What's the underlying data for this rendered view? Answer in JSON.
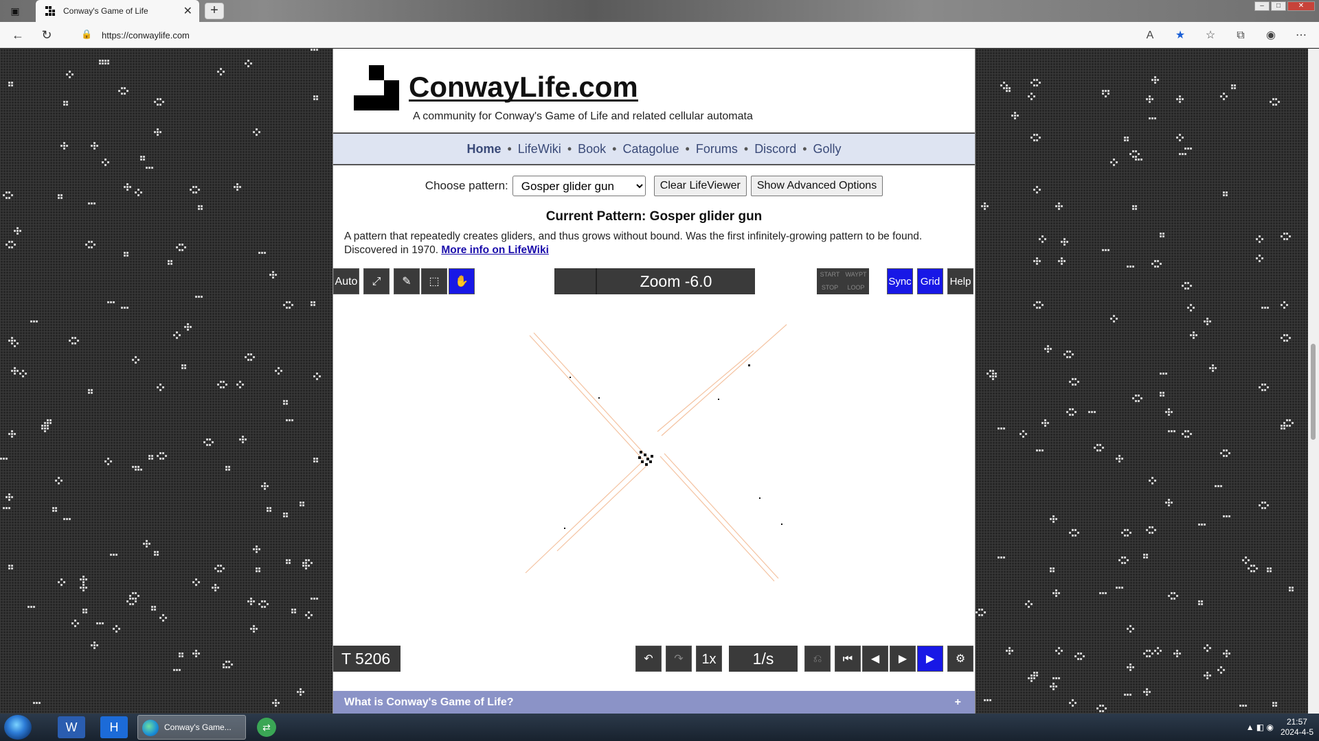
{
  "browser": {
    "tab_title": "Conway's Game of Life",
    "url": "https://conwaylife.com"
  },
  "site": {
    "title": "ConwayLife.com",
    "tagline": "A community for Conway's Game of Life and related cellular automata"
  },
  "nav": {
    "items": [
      "Home",
      "LifeWiki",
      "Book",
      "Catagolue",
      "Forums",
      "Discord",
      "Golly"
    ],
    "separator": "•"
  },
  "chooser": {
    "label": "Choose pattern:",
    "selected": "Gosper glider gun",
    "clear_button": "Clear LifeViewer",
    "advanced_button": "Show Advanced Options"
  },
  "pattern": {
    "heading": "Current Pattern: Gosper glider gun",
    "description": "A pattern that repeatedly creates gliders, and thus grows without bound. Was the first infinitely-growing pattern to be found. Discovered in 1970.",
    "link_text": "More info on LifeWiki"
  },
  "viewer": {
    "auto_label": "Auto",
    "zoom_label": "Zoom -6.0",
    "waypoint_labels": [
      "START",
      "WAYPT",
      "STOP",
      "LOOP"
    ],
    "sync_label": "Sync",
    "grid_label": "Grid",
    "help_label": "Help",
    "generation": "T 5206",
    "step_label": "1x",
    "speed_label": "1/s"
  },
  "accordion": {
    "title": "What is Conway's Game of Life?",
    "toggle": "+"
  },
  "taskbar": {
    "edge_label": "Conway's Game...",
    "time": "21:57",
    "date": "2024-4-5"
  }
}
